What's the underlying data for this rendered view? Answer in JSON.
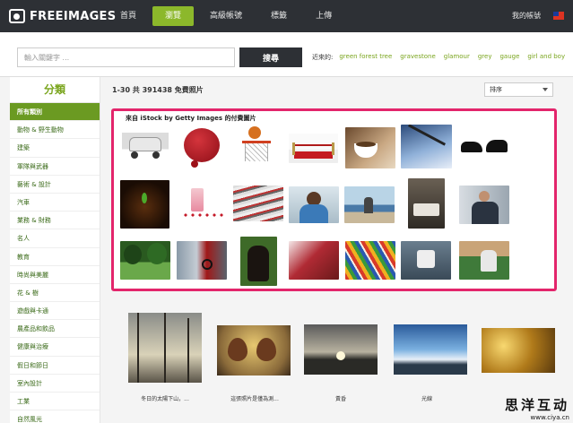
{
  "header": {
    "logo_text": "FREEIMAGES",
    "nav": [
      {
        "label": "首頁",
        "active": false
      },
      {
        "label": "瀏覽",
        "active": true
      },
      {
        "label": "高級帳號",
        "active": false
      },
      {
        "label": "標籤",
        "active": false
      },
      {
        "label": "上傳",
        "active": false
      }
    ],
    "account_label": "我的帳號"
  },
  "search": {
    "placeholder": "輸入關鍵字 ...",
    "button_label": "搜尋",
    "recent_label": "近來的:",
    "recent_terms": [
      "green forest tree",
      "gravestone",
      "glamour",
      "grey",
      "gauge",
      "girl and boy"
    ]
  },
  "sidebar": {
    "title": "分類",
    "items": [
      {
        "label": "所有類別",
        "active": true
      },
      {
        "label": "動物 & 野生動物"
      },
      {
        "label": "建築"
      },
      {
        "label": "軍隊與武器"
      },
      {
        "label": "藝術 & 設計"
      },
      {
        "label": "汽車"
      },
      {
        "label": "業務 & 財務"
      },
      {
        "label": "名人"
      },
      {
        "label": "教育"
      },
      {
        "label": "時尚與美麗"
      },
      {
        "label": "花 & 樹"
      },
      {
        "label": "遊戲與卡通"
      },
      {
        "label": "農產品和飲品"
      },
      {
        "label": "健康與治療"
      },
      {
        "label": "假日和節日"
      },
      {
        "label": "室內設計"
      },
      {
        "label": "工業"
      },
      {
        "label": "自然風光"
      }
    ]
  },
  "results": {
    "count_text": "1-30 共 391438 免費照片",
    "sort_label": "排序"
  },
  "istock": {
    "title": "來自 iStock by Getty Images 的付費圖片",
    "thumbnails": [
      {
        "name": "white-car"
      },
      {
        "name": "red-wax-seal"
      },
      {
        "name": "basketball-hoop"
      },
      {
        "name": "red-carpet"
      },
      {
        "name": "coffee-cup"
      },
      {
        "name": "pen-on-documents"
      },
      {
        "name": "bull-and-bear"
      },
      {
        "name": "hands-with-seedling"
      },
      {
        "name": "smoothie-fruits"
      },
      {
        "name": "stack-of-magazines"
      },
      {
        "name": "stressed-man"
      },
      {
        "name": "man-laptop-sea"
      },
      {
        "name": "hospital-bed"
      },
      {
        "name": "businessman-phone"
      },
      {
        "name": "park-trees"
      },
      {
        "name": "cyclist-motion"
      },
      {
        "name": "chimpanzee"
      },
      {
        "name": "shoes-closeup"
      },
      {
        "name": "colored-pencils"
      },
      {
        "name": "puzzle-hands"
      },
      {
        "name": "baseball-catcher"
      }
    ]
  },
  "photos": [
    {
      "caption": "冬日的太陽下山，..."
    },
    {
      "caption": "這張照片是僅為測..."
    },
    {
      "caption": "黃昏"
    },
    {
      "caption": "光線"
    },
    {
      "caption": ""
    }
  ],
  "watermark": {
    "cn": "思洋互动",
    "url": "www.ciya.cn"
  }
}
